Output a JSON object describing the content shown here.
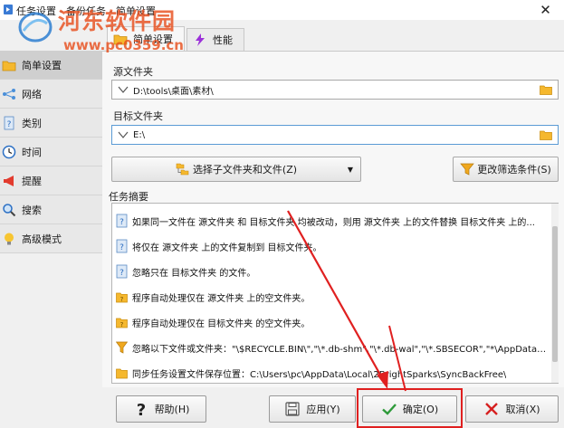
{
  "window": {
    "title": "任务设置 - 备份任务 - 简单设置",
    "close_glyph": "✕"
  },
  "watermark": {
    "brand": "河东软件园",
    "url": "www.pc0359.cn"
  },
  "tabs": [
    {
      "label": "简单设置",
      "icon": "folder-icon",
      "selected": true
    },
    {
      "label": "性能",
      "icon": "lightning-icon",
      "selected": false
    }
  ],
  "sidebar": {
    "items": [
      {
        "label": "简单设置",
        "icon": "folder-icon",
        "selected": true
      },
      {
        "label": "网络",
        "icon": "network-icon",
        "selected": false
      },
      {
        "label": "类别",
        "icon": "document-question-icon",
        "selected": false
      },
      {
        "label": "时间",
        "icon": "clock-icon",
        "selected": false
      },
      {
        "label": "提醒",
        "icon": "megaphone-icon",
        "selected": false
      },
      {
        "label": "搜索",
        "icon": "magnifier-icon",
        "selected": false
      },
      {
        "label": "高级模式",
        "icon": "lightbulb-icon",
        "selected": false
      }
    ]
  },
  "source": {
    "label": "源文件夹",
    "value": "D:\\tools\\桌面\\素材\\"
  },
  "destination": {
    "label": "目标文件夹",
    "value": "E:\\"
  },
  "buttons": {
    "select_subfolders": "选择子文件夹和文件(Z)",
    "change_filter": "更改筛选条件(S)",
    "dropdown_glyph": "▼"
  },
  "summary": {
    "label": "任务摘要",
    "rows": [
      {
        "icon": "document-question-icon",
        "text": "如果同一文件在 源文件夹 和 目标文件夹 均被改动，则用 源文件夹 上的文件替换 目标文件夹 上的..."
      },
      {
        "icon": "document-question-icon",
        "text": "将仅在 源文件夹 上的文件复制到 目标文件夹。"
      },
      {
        "icon": "document-question-icon",
        "text": "忽略只在 目标文件夹 的文件。"
      },
      {
        "icon": "folder-question-icon",
        "text": "程序自动处理仅在 源文件夹 上的空文件夹。"
      },
      {
        "icon": "folder-question-icon",
        "text": "程序自动处理仅在 目标文件夹 的空文件夹。"
      },
      {
        "icon": "filter-icon",
        "text": "忽略以下文件或文件夹：\"\\$RECYCLE.BIN\\\",\"\\*.db-shm\",\"\\*.db-wal\",\"\\*.SBSECOR\",\"*\\AppData\\Local\\Tempor..."
      },
      {
        "icon": "folder-icon",
        "text": "同步任务设置文件保存位置：C:\\Users\\pc\\AppData\\Local\\2BrightSparks\\SyncBackFree\\"
      }
    ]
  },
  "footer": {
    "help": "帮助(H)",
    "apply": "应用(Y)",
    "ok": "确定(O)",
    "cancel": "取消(X)"
  },
  "colors": {
    "accent_red": "#e02020",
    "watermark_orange": "#e8501f",
    "ok_green": "#2e9a3a",
    "cancel_red": "#d62020"
  }
}
